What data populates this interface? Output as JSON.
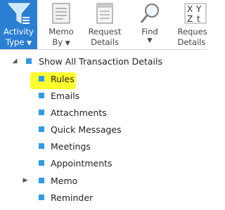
{
  "ribbon": {
    "buttons": [
      {
        "line1": "Activity",
        "line2": "Type",
        "arrow": "▼",
        "icon": "funnel-icon"
      },
      {
        "line1": "Memo",
        "line2": "By",
        "arrow": "▼",
        "icon": "memo-icon"
      },
      {
        "line1": "Request",
        "line2": "Details",
        "arrow": "",
        "icon": "request-details-icon"
      },
      {
        "line1": "Find",
        "line2": "",
        "arrow": "▼",
        "icon": "magnifier-icon"
      },
      {
        "line1": "Reques",
        "line2": "Details",
        "arrow": "",
        "icon": "sort-xyz-icon",
        "icon_text": [
          "X",
          "Y",
          "Z",
          "t"
        ]
      }
    ]
  },
  "tree": {
    "root": {
      "label": "Show All Transaction Details",
      "expander": "◢"
    },
    "items": [
      {
        "label": "Rules",
        "highlighted": true
      },
      {
        "label": "Emails"
      },
      {
        "label": "Attachments"
      },
      {
        "label": "Quick Messages"
      },
      {
        "label": "Meetings"
      },
      {
        "label": "Appointments"
      },
      {
        "label": "Memo",
        "expander": "▶"
      },
      {
        "label": "Reminder"
      }
    ]
  },
  "colors": {
    "active_button": "#2b7fd3",
    "node_square": "#2f9be3",
    "highlight": "#ffff2e"
  }
}
